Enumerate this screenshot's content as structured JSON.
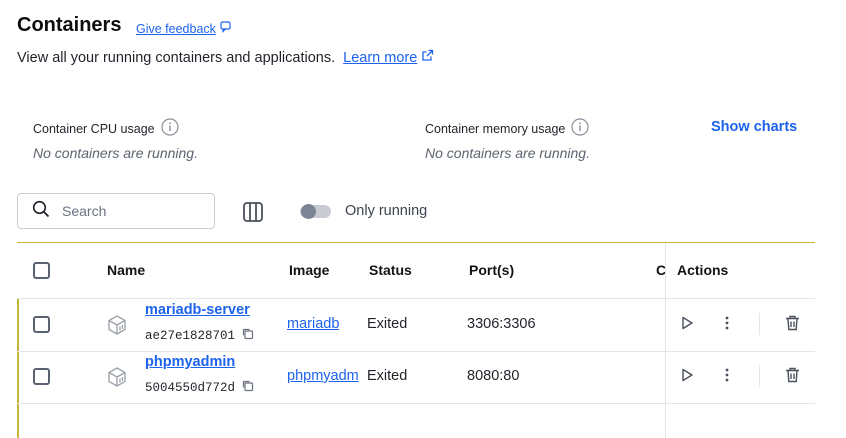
{
  "page": {
    "title": "Containers",
    "give_feedback": "Give feedback",
    "subtitle": "View all your running containers and applications.",
    "learn_more": "Learn more"
  },
  "stats": {
    "cpu_label": "Container CPU usage",
    "cpu_empty": "No containers are running.",
    "memory_label": "Container memory usage",
    "memory_empty": "No containers are running.",
    "show_charts": "Show charts"
  },
  "toolbar": {
    "search_placeholder": "Search",
    "only_running_label": "Only running",
    "only_running_enabled": false
  },
  "table": {
    "headers": {
      "name": "Name",
      "image": "Image",
      "status": "Status",
      "ports": "Port(s)",
      "truncated": "C",
      "actions": "Actions"
    },
    "rows": [
      {
        "name": "mariadb-server",
        "id": "ae27e1828701",
        "image": "mariadb",
        "status": "Exited",
        "ports": "3306:3306"
      },
      {
        "name": "phpmyadmin",
        "id": "5004550d772d",
        "image": "phpmyadm",
        "status": "Exited",
        "ports": "8080:80"
      }
    ]
  },
  "colors": {
    "accent": "#1d63ed",
    "row_highlight": "#c6b534",
    "text": "#131415"
  }
}
